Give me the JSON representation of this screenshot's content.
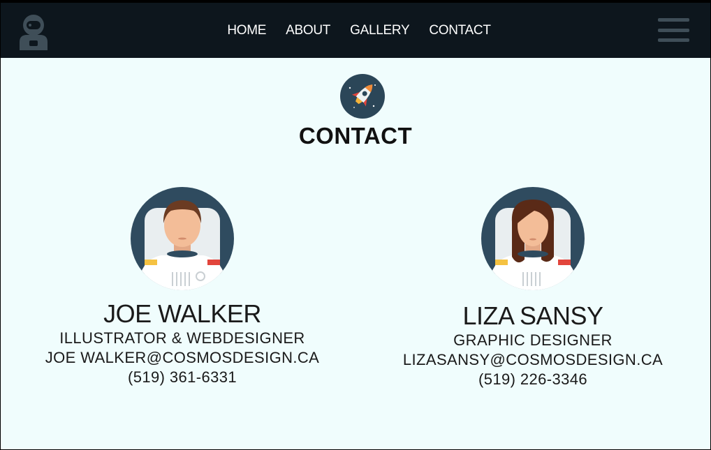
{
  "nav": {
    "logo_icon": "astronaut-icon",
    "links": [
      "HOME",
      "ABOUT",
      "GALLERY",
      "CONTACT"
    ],
    "menu_icon": "hamburger-menu-icon"
  },
  "page": {
    "badge_icon": "rocket-icon",
    "title": "CONTACT"
  },
  "contacts": [
    {
      "avatar_icon": "male-astronaut-avatar",
      "name": "JOE WALKER",
      "role": "ILLUSTRATOR & WEBDESIGNER",
      "email": "JOE WALKER@COSMOSDESIGN.CA",
      "phone": "(519) 361-6331"
    },
    {
      "avatar_icon": "female-astronaut-avatar",
      "name": "LIZA SANSY",
      "role": "GRAPHIC DESIGNER",
      "email": "LIZASANSY@COSMOSDESIGN.CA",
      "phone": "(519) 226-3346"
    }
  ],
  "colors": {
    "navbar_bg": "#0d161d",
    "page_bg": "#f0fdfd",
    "avatar_circle": "#2f4b5f",
    "icon_grey": "#3f4e58"
  }
}
